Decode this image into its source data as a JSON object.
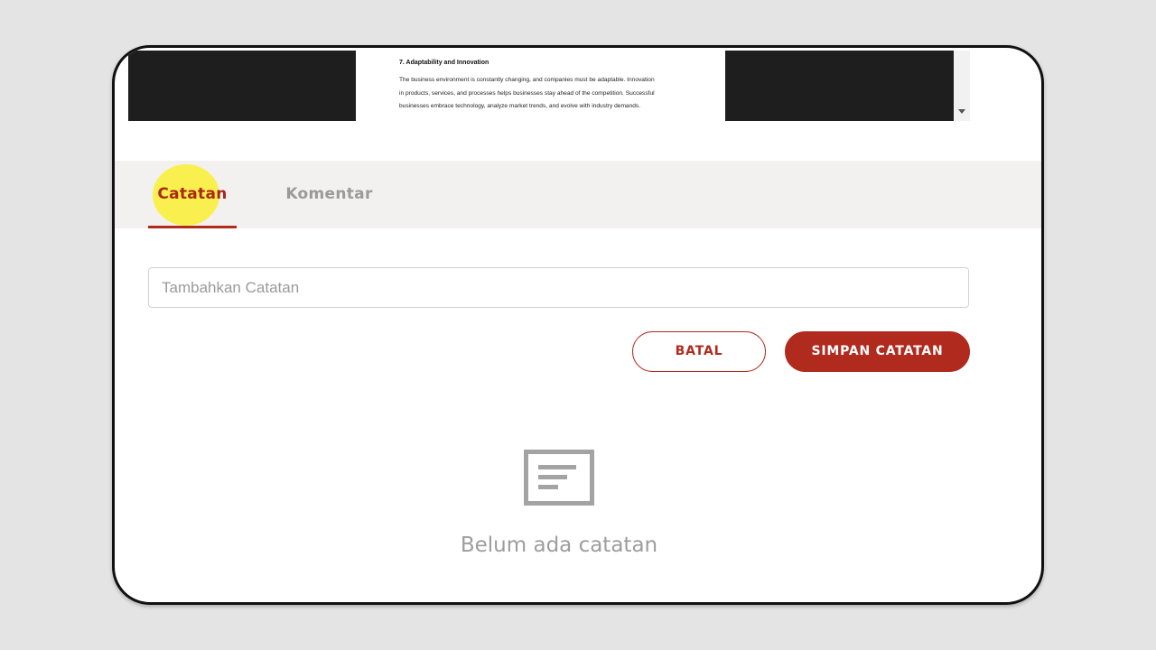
{
  "document": {
    "heading": "7. Adaptability and Innovation",
    "lines": [
      "The business environment is constantly changing, and companies must be adaptable. Innovation",
      "in products, services, and processes helps businesses stay ahead of the competition. Successful",
      "businesses embrace technology, analyze market trends, and evolve with industry demands."
    ]
  },
  "tabs": {
    "notes": "Catatan",
    "comments": "Komentar"
  },
  "note_input": {
    "placeholder": "Tambahkan Catatan",
    "value": ""
  },
  "buttons": {
    "cancel": "BATAL",
    "save": "SIMPAN CATATAN"
  },
  "empty_state": {
    "icon": "note-icon",
    "text": "Belum ada catatan"
  },
  "colors": {
    "accent": "#b02a1e",
    "highlight": "#faf028",
    "tab_bar": "#f2f1ef",
    "muted_text": "#9a9a9a"
  }
}
